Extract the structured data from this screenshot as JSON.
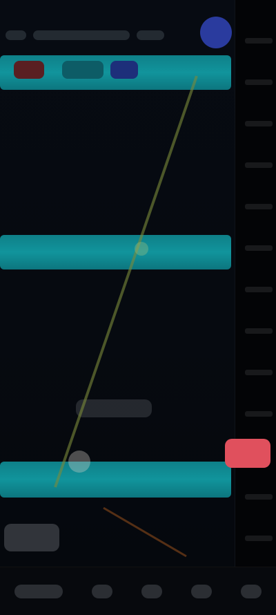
{
  "screen": {
    "name": "trading-chart",
    "accent_zone_color": "#12a0a8",
    "price_tag_color": "#e0505d",
    "trendline_color": "#7b8b3a"
  },
  "price_tag": {
    "label": ""
  },
  "zones": [
    {
      "name": "upper-zone"
    },
    {
      "name": "middle-zone"
    },
    {
      "name": "lower-zone"
    }
  ],
  "bottom_nav": {
    "items": [
      {
        "name": "timeframe-button"
      },
      {
        "name": "indicators-button"
      },
      {
        "name": "draw-button"
      },
      {
        "name": "layout-button"
      },
      {
        "name": "more-button"
      }
    ]
  }
}
